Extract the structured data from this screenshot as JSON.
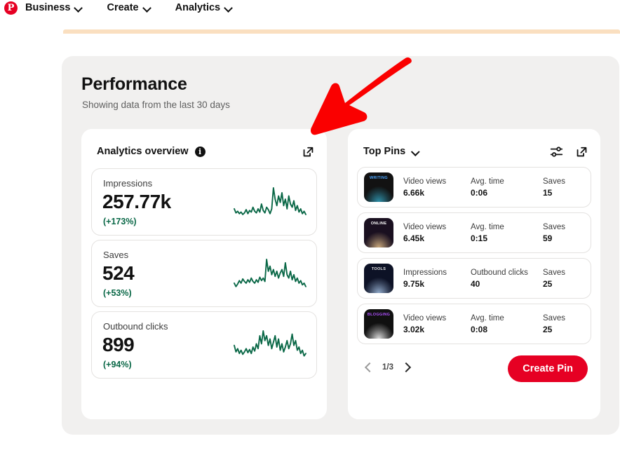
{
  "nav": {
    "logo_icon": "pinterest-logo-icon",
    "logo_glyph": "P",
    "items": [
      {
        "label": "Business",
        "icon": "chevron-down-icon"
      },
      {
        "label": "Create",
        "icon": "chevron-down-icon"
      },
      {
        "label": "Analytics",
        "icon": "chevron-down-icon"
      }
    ]
  },
  "performance": {
    "title": "Performance",
    "subtitle": "Showing data from the last 30 days"
  },
  "analytics_overview": {
    "title": "Analytics overview",
    "info_icon": "info-icon",
    "info_glyph": "i",
    "expand_icon": "external-link-icon",
    "metrics": [
      {
        "label": "Impressions",
        "value": "257.77k",
        "delta": "(+173%)"
      },
      {
        "label": "Saves",
        "value": "524",
        "delta": "(+53%)"
      },
      {
        "label": "Outbound clicks",
        "value": "899",
        "delta": "(+94%)"
      }
    ]
  },
  "top_pins": {
    "title": "Top Pins",
    "dropdown_icon": "chevron-down-icon",
    "filter_icon": "sliders-filter-icon",
    "expand_icon": "external-link-icon",
    "rows": [
      {
        "thumb": {
          "name": "pin-thumbnail",
          "text": "WRITING",
          "text_color": "#4da6ff",
          "bg": "#121212",
          "accent": "#2e8fa8"
        },
        "stats": [
          {
            "key": "Video views",
            "value": "6.66k"
          },
          {
            "key": "Avg. time",
            "value": "0:06"
          },
          {
            "key": "Saves",
            "value": "15"
          }
        ]
      },
      {
        "thumb": {
          "name": "pin-thumbnail",
          "text": "ONLINE",
          "text_color": "#ffffff",
          "bg": "#1a1020",
          "accent": "#c9a87c"
        },
        "stats": [
          {
            "key": "Video views",
            "value": "6.45k"
          },
          {
            "key": "Avg. time",
            "value": "0:15"
          },
          {
            "key": "Saves",
            "value": "59"
          }
        ]
      },
      {
        "thumb": {
          "name": "pin-thumbnail",
          "text": "TOOLS",
          "text_color": "#e8e8e8",
          "bg": "#0d1226",
          "accent": "#8fa8c8"
        },
        "stats": [
          {
            "key": "Impressions",
            "value": "9.75k"
          },
          {
            "key": "Outbound clicks",
            "value": "40"
          },
          {
            "key": "Saves",
            "value": "25"
          }
        ]
      },
      {
        "thumb": {
          "name": "pin-thumbnail",
          "text": "BLOGGING",
          "text_color": "#b050ff",
          "bg": "#101010",
          "accent": "#d9d9d9"
        },
        "stats": [
          {
            "key": "Video views",
            "value": "3.02k"
          },
          {
            "key": "Avg. time",
            "value": "0:08"
          },
          {
            "key": "Saves",
            "value": "25"
          }
        ]
      }
    ],
    "pager": {
      "prev_icon": "chevron-left-icon",
      "next_icon": "chevron-right-icon",
      "label": "1/3"
    },
    "create_pin_label": "Create Pin"
  },
  "annotation": {
    "arrow_icon": "red-arrow-annotation-icon",
    "color": "#fa0000"
  },
  "colors": {
    "brand_red": "#e60023",
    "positive_green": "#0a6847",
    "panel_gray": "#f1f0ef",
    "peach_bar": "#fadfc0"
  },
  "sparklines": {
    "impressions": [
      14,
      9,
      11,
      8,
      10,
      7,
      9,
      13,
      8,
      12,
      10,
      16,
      11,
      9,
      14,
      10,
      20,
      12,
      9,
      16,
      13,
      8,
      14,
      40,
      26,
      18,
      30,
      22,
      34,
      18,
      26,
      14,
      30,
      20,
      16,
      24,
      12,
      18,
      10,
      14,
      8,
      11,
      7
    ],
    "saves": [
      10,
      6,
      9,
      13,
      10,
      15,
      12,
      10,
      14,
      11,
      16,
      12,
      10,
      14,
      11,
      17,
      13,
      16,
      12,
      38,
      24,
      30,
      20,
      26,
      18,
      24,
      16,
      22,
      26,
      18,
      34,
      20,
      16,
      24,
      14,
      20,
      12,
      16,
      10,
      13,
      8,
      10,
      6
    ],
    "outbound_clicks": [
      22,
      14,
      18,
      12,
      16,
      11,
      14,
      18,
      13,
      17,
      12,
      20,
      15,
      24,
      18,
      34,
      24,
      40,
      28,
      34,
      22,
      30,
      18,
      26,
      34,
      20,
      30,
      16,
      24,
      14,
      20,
      28,
      18,
      24,
      36,
      22,
      28,
      16,
      20,
      12,
      16,
      9,
      12
    ]
  }
}
